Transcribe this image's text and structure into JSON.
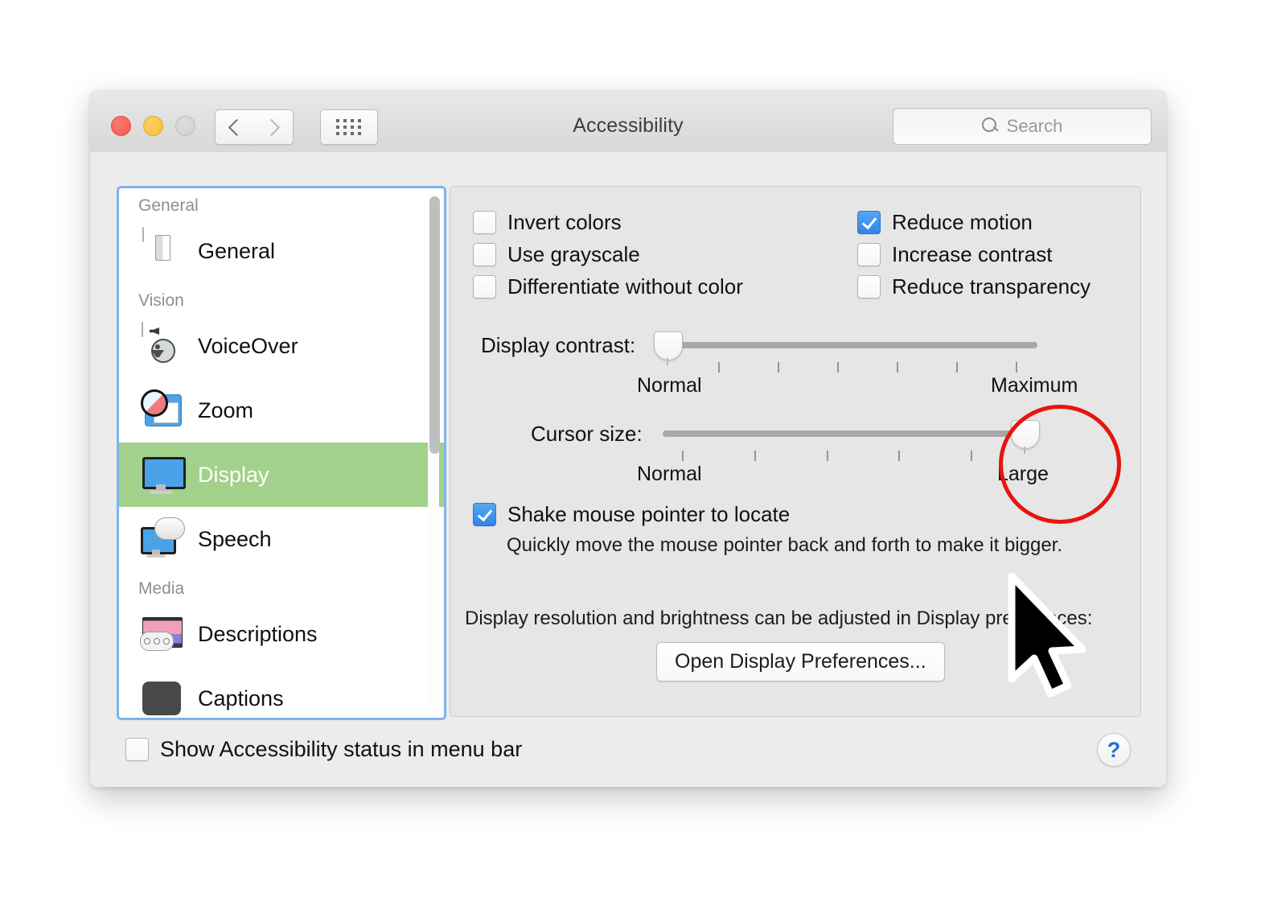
{
  "window": {
    "title": "Accessibility",
    "traffic_lights": [
      "close-button",
      "minimize-button",
      "zoom-button"
    ],
    "nav": {
      "back_icon": "chevron-left-icon",
      "forward_icon": "chevron-right-icon",
      "grid_icon": "show-all-grid-icon"
    },
    "search": {
      "placeholder": "Search",
      "value": "",
      "icon": "search-icon"
    }
  },
  "sidebar": {
    "groups": [
      {
        "label": "General",
        "items": [
          {
            "label": "General",
            "icon": "general-switch-icon",
            "selected": false
          }
        ]
      },
      {
        "label": "Vision",
        "items": [
          {
            "label": "VoiceOver",
            "icon": "voiceover-icon",
            "selected": false
          },
          {
            "label": "Zoom",
            "icon": "zoom-magnifier-icon",
            "selected": false
          },
          {
            "label": "Display",
            "icon": "display-monitor-icon",
            "selected": true
          },
          {
            "label": "Speech",
            "icon": "speech-bubble-icon",
            "selected": false
          }
        ]
      },
      {
        "label": "Media",
        "items": [
          {
            "label": "Descriptions",
            "icon": "descriptions-icon",
            "selected": false
          },
          {
            "label": "Captions",
            "icon": "captions-icon",
            "selected": false
          }
        ]
      }
    ],
    "selection_color": "#a2d18c",
    "focus_ring_color": "#7eb4ec"
  },
  "panel": {
    "checkboxes_left": [
      {
        "label": "Invert colors",
        "checked": false
      },
      {
        "label": "Use grayscale",
        "checked": false
      },
      {
        "label": "Differentiate without color",
        "checked": false
      }
    ],
    "checkboxes_right": [
      {
        "label": "Reduce motion",
        "checked": true
      },
      {
        "label": "Increase contrast",
        "checked": false
      },
      {
        "label": "Reduce transparency",
        "checked": false
      }
    ],
    "sliders": [
      {
        "label": "Display contrast:",
        "min_label": "Normal",
        "max_label": "Maximum",
        "value_percent": 0,
        "tick_count": 6
      },
      {
        "label": "Cursor size:",
        "min_label": "Normal",
        "max_label": "Large",
        "value_percent": 100,
        "tick_count": 5
      }
    ],
    "shake_checkbox": {
      "label": "Shake mouse pointer to locate",
      "checked": true
    },
    "shake_description": "Quickly move the mouse pointer back and forth to make it bigger.",
    "hint": "Display resolution and brightness can be adjusted in Display preferences:",
    "open_display_button": "Open Display Preferences..."
  },
  "bottom": {
    "menu_bar_checkbox": {
      "label": "Show Accessibility status in menu bar",
      "checked": false
    },
    "help_label": "?"
  },
  "annotations": {
    "highlight_circle_color": "#e8140f",
    "cursor_icon": "large-arrow-pointer"
  }
}
